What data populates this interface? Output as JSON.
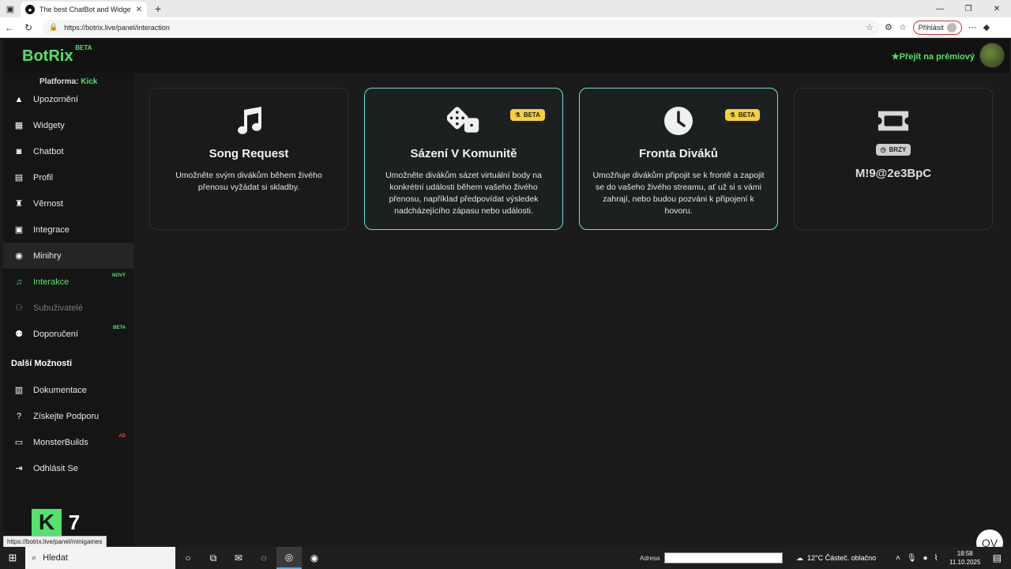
{
  "browser": {
    "tab_title": "The best ChatBot and Widgets fo",
    "tab_favicon": "botrix-favicon-icon",
    "url": "https://botrix.live/panel/interaction",
    "login_label": "Přihlásit"
  },
  "app": {
    "logo": "BotRix",
    "logo_badge": "BETA",
    "premium_link": "Přejít na prémiový",
    "platform_label": "Platforma:",
    "platform_value": "Kick"
  },
  "sidebar": {
    "items": [
      {
        "label": "Upozornění",
        "icon": "warning-icon"
      },
      {
        "label": "Widgety",
        "icon": "widgets-icon"
      },
      {
        "label": "Chatbot",
        "icon": "robot-icon"
      },
      {
        "label": "Profil",
        "icon": "id-card-icon"
      },
      {
        "label": "Věrnost",
        "icon": "trophy-icon"
      },
      {
        "label": "Integrace",
        "icon": "integration-icon"
      },
      {
        "label": "Minihry",
        "icon": "gamepad-icon"
      },
      {
        "label": "Interakce",
        "icon": "music-icon",
        "badge": "NOVÝ"
      },
      {
        "label": "Subuživatelé",
        "icon": "users-icon"
      },
      {
        "label": "Doporučení",
        "icon": "referral-icon",
        "badge": "BETA"
      }
    ],
    "section_title": "Další Možnosti",
    "more_items": [
      {
        "label": "Dokumentace",
        "icon": "book-icon"
      },
      {
        "label": "Získejte Podporu",
        "icon": "question-icon"
      },
      {
        "label": "MonsterBuilds",
        "icon": "monitor-icon",
        "badge": "AD"
      },
      {
        "label": "Odhlásit Se",
        "icon": "logout-icon"
      }
    ],
    "kick_letter": "K",
    "kick_number": "7"
  },
  "cards": [
    {
      "title": "Song Request",
      "desc": "Umožněte svým divákům během živého přenosu vyžádat si skladby.",
      "icon": "music-note-icon"
    },
    {
      "title": "Sázení V Komunitě",
      "desc": "Umožněte divákům sázet virtuální body na konkrétní události během vašeho živého přenosu, například předpovídat výsledek nadcházejícího zápasu nebo události.",
      "icon": "dice-icon",
      "badge": "BETA"
    },
    {
      "title": "Fronta Diváků",
      "desc": "Umožňuje divákům připojit se k frontě a zapojit se do vašeho živého streamu, ať už si s vámi zahrají, nebo budou pozváni k připojení k hovoru.",
      "icon": "clock-icon",
      "badge": "BETA"
    },
    {
      "code": "M!9@2e3BpC",
      "icon": "ticket-icon",
      "badge": "BRZY"
    }
  ],
  "status_url": "https://botrix.live/panel/minigames",
  "taskbar": {
    "search": "Hledat",
    "adresa": "Adresa",
    "weather": "12°C  Částeč. oblačno",
    "time": "18:58",
    "date": "11.10.2025"
  },
  "colors": {
    "accent": "#53e26b",
    "highlight_border": "#6ee0d0",
    "beta_badge": "#f3d23c"
  }
}
